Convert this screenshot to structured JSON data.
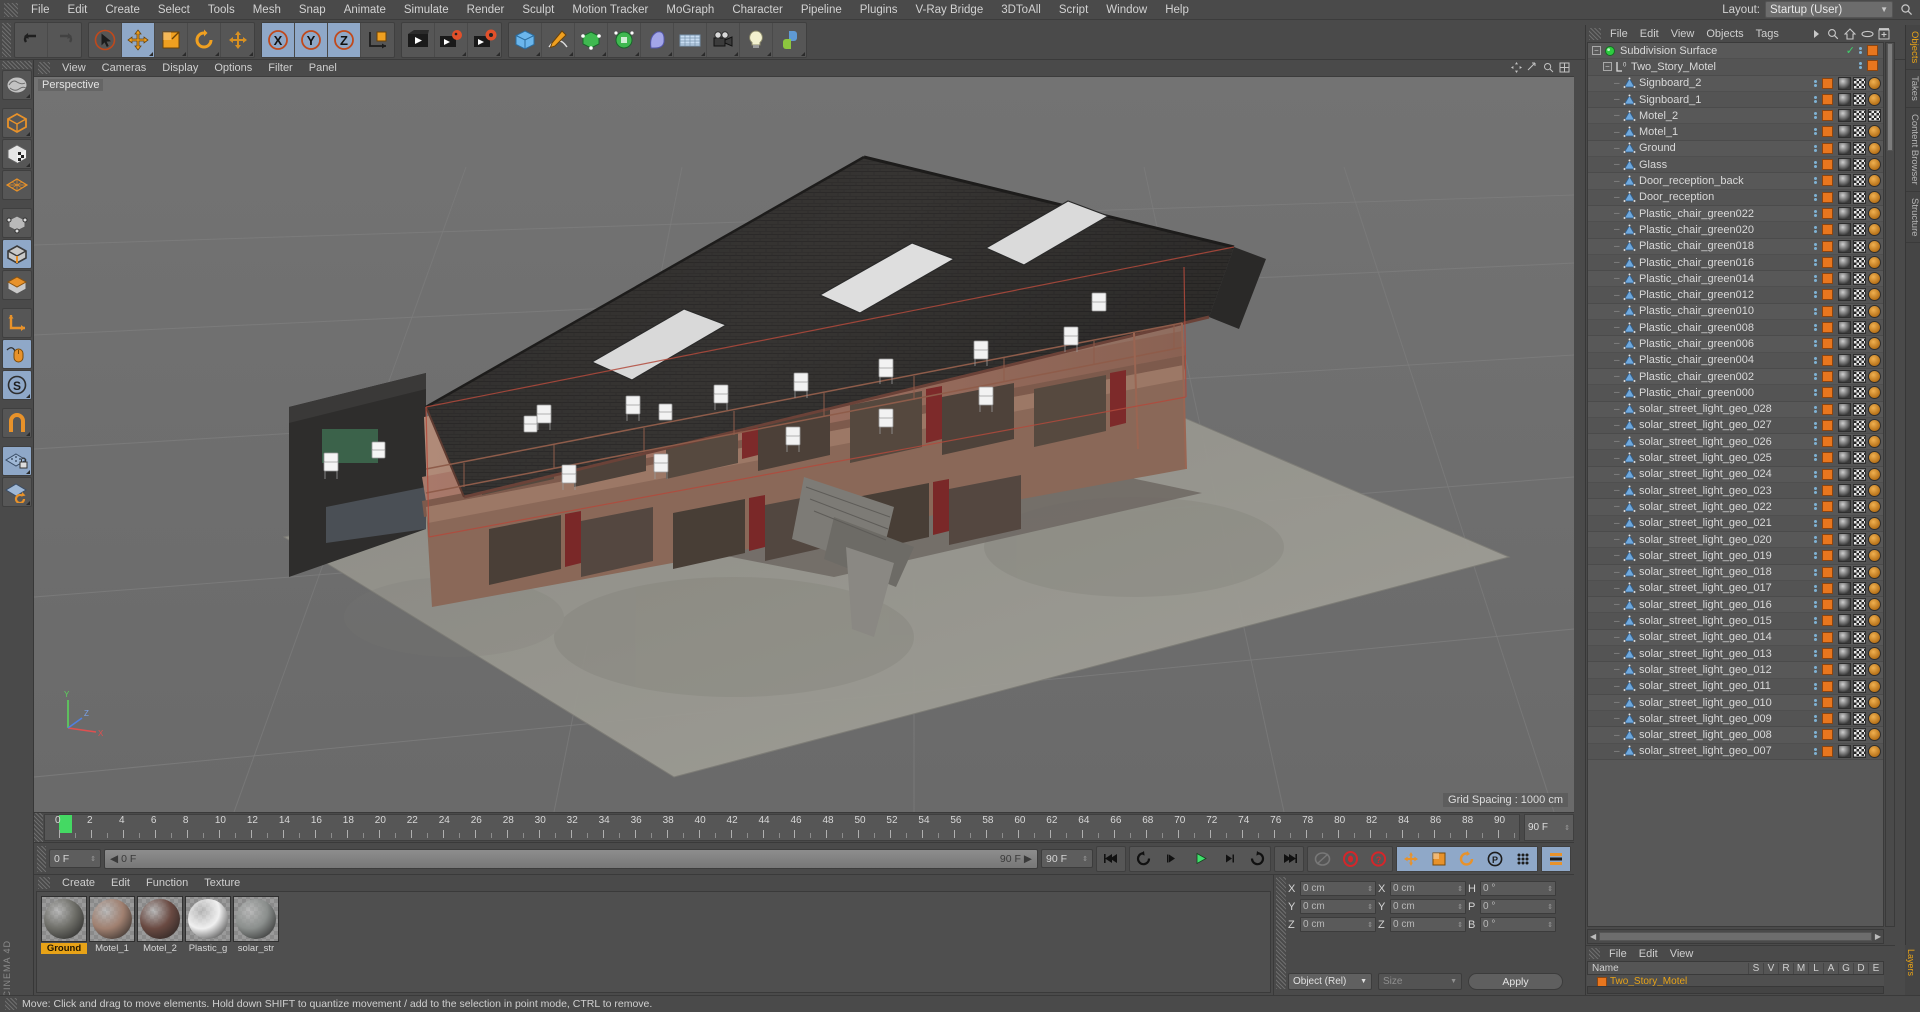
{
  "app": {
    "brand": "CINEMA 4D",
    "layout_label": "Layout:",
    "layout_value": "Startup (User)"
  },
  "menubar": {
    "items": [
      "File",
      "Edit",
      "Create",
      "Select",
      "Tools",
      "Mesh",
      "Snap",
      "Animate",
      "Simulate",
      "Render",
      "Sculpt",
      "Motion Tracker",
      "MoGraph",
      "Character",
      "Pipeline",
      "Plugins",
      "V-Ray Bridge",
      "3DToAll",
      "Script",
      "Window",
      "Help"
    ]
  },
  "toolbar": {
    "groups": [
      {
        "name": "history",
        "buttons": [
          {
            "icon": "undo-icon",
            "active": false
          },
          {
            "icon": "redo-icon",
            "active": false
          }
        ]
      },
      {
        "name": "transform",
        "buttons": [
          {
            "icon": "select-live-icon",
            "active": false
          },
          {
            "icon": "move-icon",
            "active": true
          },
          {
            "icon": "scale-icon",
            "active": false
          },
          {
            "icon": "rotate-icon",
            "active": false
          },
          {
            "icon": "move-dup-icon",
            "active": false
          }
        ]
      },
      {
        "name": "axis-locks",
        "buttons": [
          {
            "icon": "axis-x-icon",
            "active": true
          },
          {
            "icon": "axis-y-icon",
            "active": true
          },
          {
            "icon": "axis-z-icon",
            "active": true
          },
          {
            "icon": "world-object-axis-icon",
            "active": false
          }
        ]
      },
      {
        "name": "render",
        "buttons": [
          {
            "icon": "render-view-icon",
            "active": false
          },
          {
            "icon": "render-region-icon",
            "active": false
          },
          {
            "icon": "render-settings-icon",
            "active": false
          }
        ]
      },
      {
        "name": "create",
        "buttons": [
          {
            "icon": "cube-primitive-icon",
            "active": false
          },
          {
            "icon": "spline-pen-icon",
            "active": false
          },
          {
            "icon": "generator-icon",
            "active": false
          },
          {
            "icon": "deformer-icon",
            "active": false
          },
          {
            "icon": "bend-icon",
            "active": false
          },
          {
            "icon": "environment-icon",
            "active": false
          },
          {
            "icon": "camera-icon",
            "active": false
          },
          {
            "icon": "light-icon",
            "active": false
          },
          {
            "icon": "python-icon",
            "active": false
          }
        ]
      }
    ]
  },
  "left_palette": {
    "buttons": [
      {
        "icon": "live-selection-icon",
        "active": false
      },
      {
        "icon": "model-mode-icon",
        "active": false
      },
      {
        "icon": "texture-mode-icon",
        "active": false
      },
      {
        "icon": "workplane-icon",
        "active": false
      },
      {
        "icon": "point-mode-icon",
        "active": false
      },
      {
        "icon": "edge-mode-icon",
        "active": true
      },
      {
        "icon": "polygon-mode-icon",
        "active": false
      },
      {
        "icon": "axis-mode-icon",
        "active": false
      },
      {
        "icon": "enable-axis-icon",
        "active": true
      },
      {
        "icon": "soft-selection-icon",
        "active": true
      },
      {
        "icon": "magnet-icon",
        "active": false
      },
      {
        "icon": "lock-workplane-icon",
        "active": true
      },
      {
        "icon": "planar-workplane-icon",
        "active": false
      }
    ]
  },
  "viewport": {
    "menu": [
      "View",
      "Cameras",
      "Display",
      "Options",
      "Filter",
      "Panel"
    ],
    "label": "Perspective",
    "grid_spacing": "Grid Spacing : 1000 cm",
    "axis_labels": {
      "x": "X",
      "y": "Y",
      "z": "Z"
    },
    "scene_description": "Two-story motel building in perspective view with dark shingled roof, walkway balconies, white plastic chairs, and ground plane"
  },
  "timeline": {
    "start_frame": "0 F",
    "current_frame": "0 F",
    "end_frame": "90 F",
    "preview_end": "90 F",
    "range_end": "90 F",
    "ticks": [
      0,
      2,
      4,
      6,
      8,
      10,
      12,
      14,
      16,
      18,
      20,
      22,
      24,
      26,
      28,
      30,
      32,
      34,
      36,
      38,
      40,
      42,
      44,
      46,
      48,
      50,
      52,
      54,
      56,
      58,
      60,
      62,
      64,
      66,
      68,
      70,
      72,
      74,
      76,
      78,
      80,
      82,
      84,
      86,
      88,
      90
    ],
    "transport_buttons": [
      {
        "icon": "go-to-start-icon",
        "on": false
      },
      {
        "icon": "play-backwards-loop-icon",
        "on": false
      },
      {
        "icon": "step-back-icon",
        "on": false
      },
      {
        "icon": "play-icon",
        "on": false
      },
      {
        "icon": "step-forward-icon",
        "on": false
      },
      {
        "icon": "play-forward-loop-icon",
        "on": false
      },
      {
        "icon": "go-to-end-icon",
        "on": false
      }
    ],
    "record_buttons": [
      {
        "icon": "autokey-icon",
        "on": false
      },
      {
        "icon": "record-active-objects-icon",
        "on": false
      },
      {
        "icon": "keyframe-selection-icon",
        "on": false
      }
    ],
    "key_toggles": [
      {
        "icon": "position-key-icon",
        "on": true
      },
      {
        "icon": "scale-key-icon",
        "on": true
      },
      {
        "icon": "rotation-key-icon",
        "on": true
      },
      {
        "icon": "parameter-key-icon",
        "on": true
      },
      {
        "icon": "point-level-anim-icon",
        "on": true
      },
      {
        "icon": "timeline-icon",
        "on": true
      }
    ]
  },
  "material_manager": {
    "menu": [
      "Create",
      "Edit",
      "Function",
      "Texture"
    ],
    "materials": [
      {
        "name": "Ground",
        "selected": true,
        "color": "#6e6e68"
      },
      {
        "name": "Motel_1",
        "selected": false,
        "color": "#a08070"
      },
      {
        "name": "Motel_2",
        "selected": false,
        "color": "#6a4a42"
      },
      {
        "name": "Plastic_g",
        "selected": false,
        "color": "#f0f0f0"
      },
      {
        "name": "solar_str",
        "selected": false,
        "color": "#8b8f8d"
      }
    ]
  },
  "coordinates": {
    "position": {
      "label_x": "X",
      "label_y": "Y",
      "label_z": "Z",
      "x": "0 cm",
      "y": "0 cm",
      "z": "0 cm"
    },
    "size": {
      "label_x": "X",
      "label_y": "Y",
      "label_z": "Z",
      "x": "0 cm",
      "y": "0 cm",
      "z": "0 cm"
    },
    "rotation": {
      "label_h": "H",
      "label_p": "P",
      "label_b": "B",
      "h": "0 °",
      "p": "0 °",
      "b": "0 °"
    },
    "mode": "Object (Rel)",
    "size_mode": "Size",
    "apply": "Apply"
  },
  "status": {
    "text": "Move: Click and drag to move elements. Hold down SHIFT to quantize movement / add to the selection in point mode, CTRL to remove."
  },
  "object_manager": {
    "menu": [
      "File",
      "Edit",
      "View",
      "Objects",
      "Tags"
    ],
    "tabs": [
      "Objects",
      "Takes",
      "Content Browser",
      "Structure"
    ],
    "active_tab": "Objects",
    "items": [
      {
        "name": "Subdivision Surface",
        "depth": 0,
        "icon": "subdivision-surface-icon",
        "expandable": true,
        "enabled": true,
        "check": true,
        "tags": []
      },
      {
        "name": "Two_Story_Motel",
        "depth": 1,
        "icon": "null-object-icon",
        "expandable": true,
        "enabled": true,
        "tags": []
      },
      {
        "name": "Signboard_2",
        "depth": 2,
        "icon": "polygon-object-icon",
        "tags": [
          "material",
          "uv",
          "selection"
        ]
      },
      {
        "name": "Signboard_1",
        "depth": 2,
        "icon": "polygon-object-icon",
        "tags": [
          "material",
          "uv",
          "selection"
        ]
      },
      {
        "name": "Motel_2",
        "depth": 2,
        "icon": "polygon-object-icon",
        "tags": [
          "material",
          "uv",
          "uv2"
        ]
      },
      {
        "name": "Motel_1",
        "depth": 2,
        "icon": "polygon-object-icon",
        "tags": [
          "material",
          "uv",
          "selection"
        ]
      },
      {
        "name": "Ground",
        "depth": 2,
        "icon": "polygon-object-icon",
        "tags": [
          "material",
          "uv",
          "selection"
        ]
      },
      {
        "name": "Glass",
        "depth": 2,
        "icon": "polygon-object-icon",
        "tags": [
          "material",
          "uv",
          "selection"
        ]
      },
      {
        "name": "Door_reception_back",
        "depth": 2,
        "icon": "polygon-object-icon",
        "tags": [
          "material",
          "uv",
          "selection"
        ]
      },
      {
        "name": "Door_reception",
        "depth": 2,
        "icon": "polygon-object-icon",
        "tags": [
          "material",
          "uv",
          "selection"
        ]
      },
      {
        "name": "Plastic_chair_green022",
        "depth": 2,
        "icon": "polygon-object-icon",
        "tags": [
          "material",
          "uv",
          "selection"
        ]
      },
      {
        "name": "Plastic_chair_green020",
        "depth": 2,
        "icon": "polygon-object-icon",
        "tags": [
          "material",
          "uv",
          "selection"
        ]
      },
      {
        "name": "Plastic_chair_green018",
        "depth": 2,
        "icon": "polygon-object-icon",
        "tags": [
          "material",
          "uv",
          "selection"
        ]
      },
      {
        "name": "Plastic_chair_green016",
        "depth": 2,
        "icon": "polygon-object-icon",
        "tags": [
          "material",
          "uv",
          "selection"
        ]
      },
      {
        "name": "Plastic_chair_green014",
        "depth": 2,
        "icon": "polygon-object-icon",
        "tags": [
          "material",
          "uv",
          "selection"
        ]
      },
      {
        "name": "Plastic_chair_green012",
        "depth": 2,
        "icon": "polygon-object-icon",
        "tags": [
          "material",
          "uv",
          "selection"
        ]
      },
      {
        "name": "Plastic_chair_green010",
        "depth": 2,
        "icon": "polygon-object-icon",
        "tags": [
          "material",
          "uv",
          "selection"
        ]
      },
      {
        "name": "Plastic_chair_green008",
        "depth": 2,
        "icon": "polygon-object-icon",
        "tags": [
          "material",
          "uv",
          "selection"
        ]
      },
      {
        "name": "Plastic_chair_green006",
        "depth": 2,
        "icon": "polygon-object-icon",
        "tags": [
          "material",
          "uv",
          "selection"
        ]
      },
      {
        "name": "Plastic_chair_green004",
        "depth": 2,
        "icon": "polygon-object-icon",
        "tags": [
          "material",
          "uv",
          "selection"
        ]
      },
      {
        "name": "Plastic_chair_green002",
        "depth": 2,
        "icon": "polygon-object-icon",
        "tags": [
          "material",
          "uv",
          "selection"
        ]
      },
      {
        "name": "Plastic_chair_green000",
        "depth": 2,
        "icon": "polygon-object-icon",
        "tags": [
          "material",
          "uv",
          "selection"
        ]
      },
      {
        "name": "solar_street_light_geo_028",
        "depth": 2,
        "icon": "polygon-object-icon",
        "tags": [
          "material",
          "uv",
          "selection"
        ]
      },
      {
        "name": "solar_street_light_geo_027",
        "depth": 2,
        "icon": "polygon-object-icon",
        "tags": [
          "material",
          "uv",
          "selection"
        ]
      },
      {
        "name": "solar_street_light_geo_026",
        "depth": 2,
        "icon": "polygon-object-icon",
        "tags": [
          "material",
          "uv",
          "selection"
        ]
      },
      {
        "name": "solar_street_light_geo_025",
        "depth": 2,
        "icon": "polygon-object-icon",
        "tags": [
          "material",
          "uv",
          "selection"
        ]
      },
      {
        "name": "solar_street_light_geo_024",
        "depth": 2,
        "icon": "polygon-object-icon",
        "tags": [
          "material",
          "uv",
          "selection"
        ]
      },
      {
        "name": "solar_street_light_geo_023",
        "depth": 2,
        "icon": "polygon-object-icon",
        "tags": [
          "material",
          "uv",
          "selection"
        ]
      },
      {
        "name": "solar_street_light_geo_022",
        "depth": 2,
        "icon": "polygon-object-icon",
        "tags": [
          "material",
          "uv",
          "selection"
        ]
      },
      {
        "name": "solar_street_light_geo_021",
        "depth": 2,
        "icon": "polygon-object-icon",
        "tags": [
          "material",
          "uv",
          "selection"
        ]
      },
      {
        "name": "solar_street_light_geo_020",
        "depth": 2,
        "icon": "polygon-object-icon",
        "tags": [
          "material",
          "uv",
          "selection"
        ]
      },
      {
        "name": "solar_street_light_geo_019",
        "depth": 2,
        "icon": "polygon-object-icon",
        "tags": [
          "material",
          "uv",
          "selection"
        ]
      },
      {
        "name": "solar_street_light_geo_018",
        "depth": 2,
        "icon": "polygon-object-icon",
        "tags": [
          "material",
          "uv",
          "selection"
        ]
      },
      {
        "name": "solar_street_light_geo_017",
        "depth": 2,
        "icon": "polygon-object-icon",
        "tags": [
          "material",
          "uv",
          "selection"
        ]
      },
      {
        "name": "solar_street_light_geo_016",
        "depth": 2,
        "icon": "polygon-object-icon",
        "tags": [
          "material",
          "uv",
          "selection"
        ]
      },
      {
        "name": "solar_street_light_geo_015",
        "depth": 2,
        "icon": "polygon-object-icon",
        "tags": [
          "material",
          "uv",
          "selection"
        ]
      },
      {
        "name": "solar_street_light_geo_014",
        "depth": 2,
        "icon": "polygon-object-icon",
        "tags": [
          "material",
          "uv",
          "selection"
        ]
      },
      {
        "name": "solar_street_light_geo_013",
        "depth": 2,
        "icon": "polygon-object-icon",
        "tags": [
          "material",
          "uv",
          "selection"
        ]
      },
      {
        "name": "solar_street_light_geo_012",
        "depth": 2,
        "icon": "polygon-object-icon",
        "tags": [
          "material",
          "uv",
          "selection"
        ]
      },
      {
        "name": "solar_street_light_geo_011",
        "depth": 2,
        "icon": "polygon-object-icon",
        "tags": [
          "material",
          "uv",
          "selection"
        ]
      },
      {
        "name": "solar_street_light_geo_010",
        "depth": 2,
        "icon": "polygon-object-icon",
        "tags": [
          "material",
          "uv",
          "selection"
        ]
      },
      {
        "name": "solar_street_light_geo_009",
        "depth": 2,
        "icon": "polygon-object-icon",
        "tags": [
          "material",
          "uv",
          "selection"
        ]
      },
      {
        "name": "solar_street_light_geo_008",
        "depth": 2,
        "icon": "polygon-object-icon",
        "tags": [
          "material",
          "uv",
          "selection"
        ]
      },
      {
        "name": "solar_street_light_geo_007",
        "depth": 2,
        "icon": "polygon-object-icon",
        "tags": [
          "material",
          "uv",
          "selection"
        ]
      }
    ]
  },
  "layer_manager": {
    "menu": [
      "File",
      "Edit",
      "View"
    ],
    "columns": [
      "Name",
      "S",
      "V",
      "R",
      "M",
      "L",
      "A",
      "G",
      "D",
      "E"
    ],
    "rows": [
      {
        "name": "Two_Story_Motel"
      }
    ],
    "tab": "Layers"
  }
}
